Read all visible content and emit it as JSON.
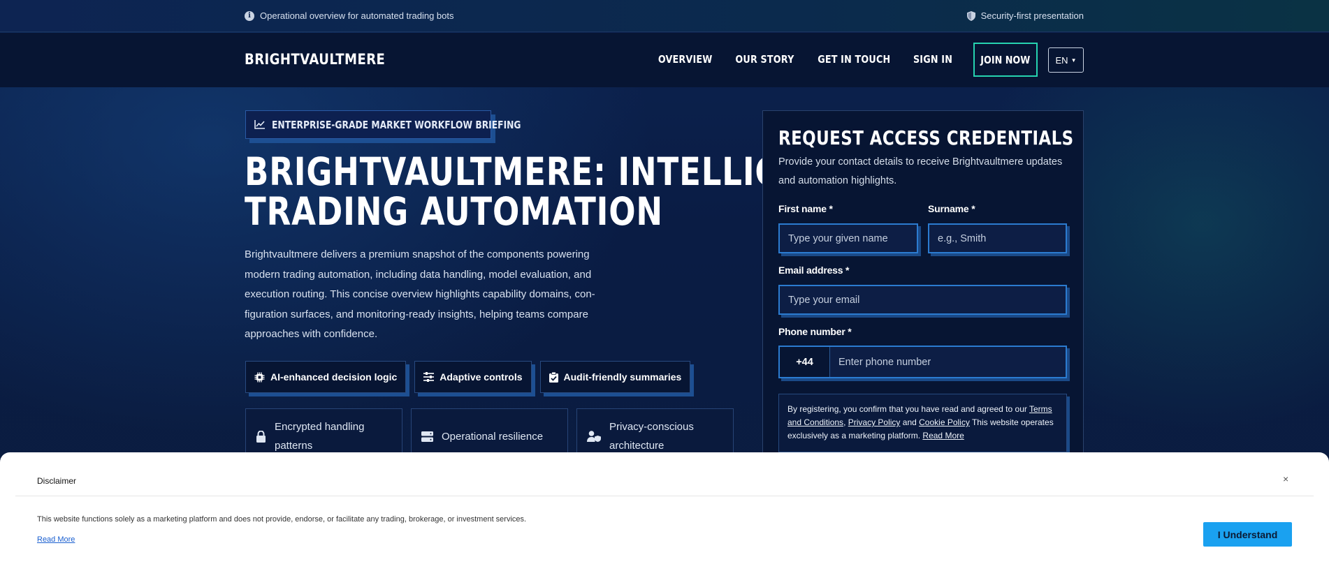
{
  "topbar": {
    "left_text": "Operational overview for automated trading bots",
    "right_text": "Security-first presentation"
  },
  "nav": {
    "logo": "BRIGHTVAULTMERE",
    "links": [
      "OVERVIEW",
      "OUR STORY",
      "GET IN TOUCH",
      "SIGN IN"
    ],
    "join_label": "JOIN NOW",
    "language": "EN"
  },
  "hero": {
    "badge": "ENTERPRISE-GRADE MARKET WORKFLOW BRIEFING",
    "title_line1": "BRIGHTVAULTMERE: INTELLIGENT",
    "title_line2": "TRADING AUTOMATION",
    "description": "Brightvaultmere delivers a premium snapshot of the components powering modern trading automation, including data handling, model evaluation, and execution routing. This concise overview highlights capability domains, con-figuration surfaces, and monitoring-ready insights, helping teams compare approaches with confidence.",
    "chips": [
      "AI-enhanced decision logic",
      "Adaptive controls",
      "Audit-friendly summaries"
    ],
    "features": [
      "Encrypted handling patterns",
      "Operational resilience",
      "Privacy-conscious architecture"
    ]
  },
  "form": {
    "title": "REQUEST ACCESS CREDENTIALS",
    "subtitle": "Provide your contact details to receive Brightvaultmere updates and automation highlights.",
    "first_name_label": "First name *",
    "first_name_placeholder": "Type your given name",
    "surname_label": "Surname *",
    "surname_placeholder": "e.g., Smith",
    "email_label": "Email address *",
    "email_placeholder": "Type your email",
    "phone_label": "Phone number *",
    "phone_code": "+44",
    "phone_placeholder": "Enter phone number",
    "consent_prefix": "By registering, you confirm that you have read and agreed to our",
    "terms_link": "Terms and Conditions",
    "privacy_link": "Privacy Policy",
    "and_text": "and",
    "cookie_link": "Cookie Policy",
    "consent_suffix": "This website operates exclusively as a marketing platform.",
    "read_more": "Read More"
  },
  "disclaimer": {
    "title": "Disclaimer",
    "text": "This website functions solely as a marketing platform and does not provide, endorse, or facilitate any trading, brokerage, or investment services.",
    "read_more": "Read More",
    "button": "I Understand",
    "close": "×"
  }
}
